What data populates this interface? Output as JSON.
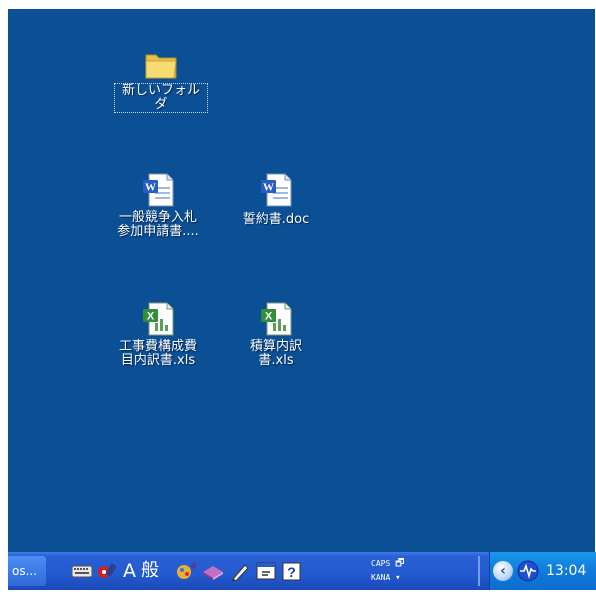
{
  "desktop": {
    "background": "#0b4f95",
    "icons": [
      {
        "label": "新しいフォルダ",
        "icon": "folder-icon"
      },
      {
        "label": "一般競争入札参加申請書....",
        "icon": "word-document-icon"
      },
      {
        "label": "誓約書.doc",
        "icon": "word-document-icon"
      },
      {
        "label": "工事費構成費目内訳書.xls",
        "icon": "excel-spreadsheet-icon"
      },
      {
        "label": "積算内訳書.xls",
        "icon": "excel-spreadsheet-icon"
      }
    ]
  },
  "taskbar": {
    "task_button_label": "os...",
    "language_bar": {
      "input_mode": "A",
      "conversion_mode": "般",
      "caps_label": "CAPS",
      "kana_label": "KANA"
    },
    "tray": {
      "clock": "13:04"
    }
  }
}
